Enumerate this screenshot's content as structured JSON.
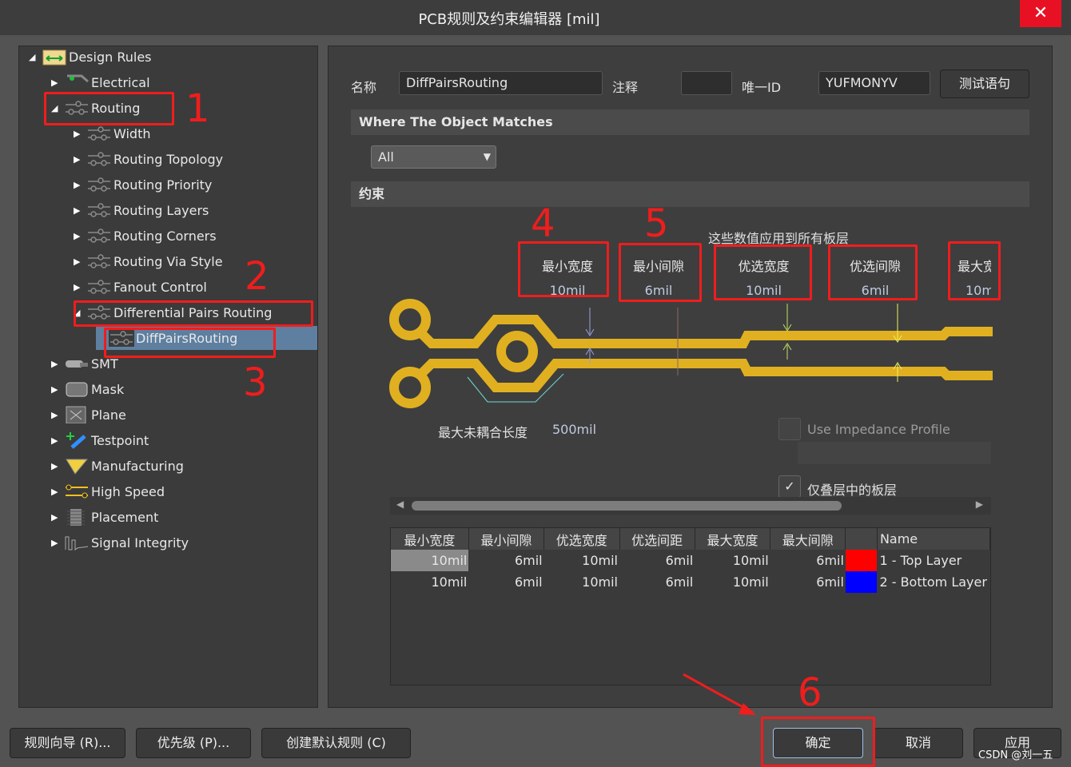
{
  "window": {
    "title": "PCB规则及约束编辑器 [mil]",
    "close_icon": "close-icon"
  },
  "tree": {
    "items": [
      {
        "label": "Design Rules",
        "level": 0,
        "expanded": true,
        "icon": "folder-rules-icon"
      },
      {
        "label": "Electrical",
        "level": 1,
        "icon": "electrical-icon"
      },
      {
        "label": "Routing",
        "level": 1,
        "expanded": true,
        "icon": "routing-icon"
      },
      {
        "label": "Width",
        "level": 2,
        "icon": "routing-icon"
      },
      {
        "label": "Routing Topology",
        "level": 2,
        "icon": "routing-icon"
      },
      {
        "label": "Routing Priority",
        "level": 2,
        "icon": "routing-icon"
      },
      {
        "label": "Routing Layers",
        "level": 2,
        "icon": "routing-icon"
      },
      {
        "label": "Routing Corners",
        "level": 2,
        "icon": "routing-icon"
      },
      {
        "label": "Routing Via Style",
        "level": 2,
        "icon": "routing-icon"
      },
      {
        "label": "Fanout Control",
        "level": 2,
        "icon": "routing-icon"
      },
      {
        "label": "Differential Pairs Routing",
        "level": 2,
        "expanded": true,
        "icon": "routing-icon"
      },
      {
        "label": "DiffPairsRouting",
        "level": 3,
        "selected": true,
        "icon": "routing-icon"
      },
      {
        "label": "SMT",
        "level": 1,
        "icon": "smt-icon"
      },
      {
        "label": "Mask",
        "level": 1,
        "icon": "mask-icon"
      },
      {
        "label": "Plane",
        "level": 1,
        "icon": "plane-icon"
      },
      {
        "label": "Testpoint",
        "level": 1,
        "icon": "testpoint-icon"
      },
      {
        "label": "Manufacturing",
        "level": 1,
        "icon": "manufacturing-icon"
      },
      {
        "label": "High Speed",
        "level": 1,
        "icon": "high-speed-icon"
      },
      {
        "label": "Placement",
        "level": 1,
        "icon": "placement-icon"
      },
      {
        "label": "Signal Integrity",
        "level": 1,
        "icon": "signal-integrity-icon"
      }
    ]
  },
  "annotations": [
    "1",
    "2",
    "3",
    "4",
    "5",
    "6"
  ],
  "rule": {
    "name_label": "名称",
    "name_value": "DiffPairsRouting",
    "comment_label": "注释",
    "comment_value": "",
    "uid_label": "唯一ID",
    "uid_value": "YUFMONYV",
    "test_button": "测试语句"
  },
  "match": {
    "header": "Where The Object Matches",
    "dropdown_value": "All"
  },
  "constraints": {
    "header": "约束",
    "all_layers_note": "这些数值应用到所有板层",
    "boxes": [
      {
        "label": "最小宽度",
        "value": "10mil"
      },
      {
        "label": "最小间隙",
        "value": "6mil"
      },
      {
        "label": "优选宽度",
        "value": "10mil"
      },
      {
        "label": "优选间隙",
        "value": "6mil"
      },
      {
        "label": "最大宽",
        "value": "10m"
      }
    ],
    "max_uncoupled_label": "最大未耦合长度",
    "max_uncoupled_value": "500mil",
    "impedance_label": "Use Impedance Profile",
    "impedance_checked": false,
    "stack_only_label": "仅叠层中的板层",
    "stack_only_checked": true
  },
  "layer_table": {
    "headers": [
      "最小宽度",
      "最小间隙",
      "优选宽度",
      "优选间距",
      "最大宽度",
      "最大间隙",
      "",
      "Name"
    ],
    "rows": [
      {
        "cells": [
          "10mil",
          "6mil",
          "10mil",
          "6mil",
          "10mil",
          "6mil"
        ],
        "color": "#ff0000",
        "name": "1 - Top Layer"
      },
      {
        "cells": [
          "10mil",
          "6mil",
          "10mil",
          "6mil",
          "10mil",
          "6mil"
        ],
        "color": "#0000ff",
        "name": "2 - Bottom Layer"
      }
    ]
  },
  "footer": {
    "wizard": "规则向导 (R)...",
    "priority": "优先级 (P)...",
    "create_default": "创建默认规则 (C)",
    "ok": "确定",
    "cancel": "取消",
    "apply": "应用",
    "watermark": "CSDN @刘一五"
  },
  "colors": {
    "trace": "#e0b020",
    "annotation": "#f01d1d",
    "selection": "#5e7fa0"
  }
}
